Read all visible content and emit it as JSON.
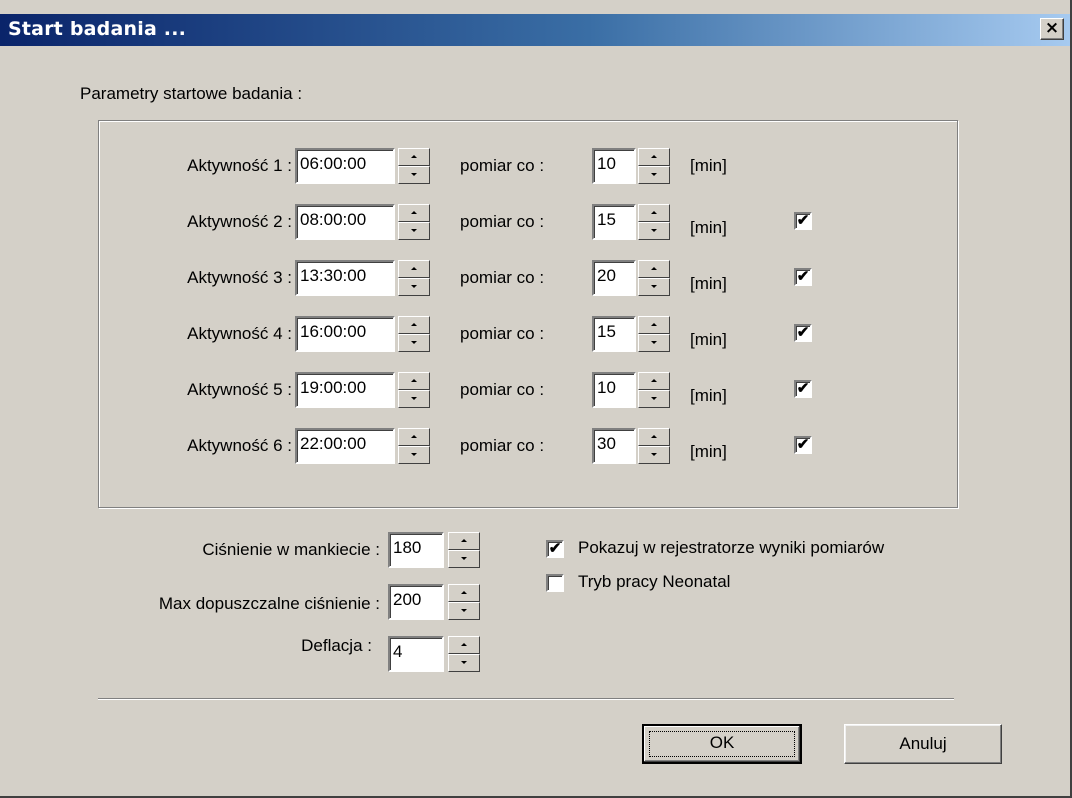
{
  "window": {
    "title": "Start badania ...",
    "close_label": "×"
  },
  "section_label": "Parametry startowe badania :",
  "activities": [
    {
      "label": "Aktywność 1 :",
      "time": "06:00:00",
      "interval_label": "pomiar co :",
      "interval": "10",
      "unit": "[min]",
      "enabled": null
    },
    {
      "label": "Aktywność 2 :",
      "time": "08:00:00",
      "interval_label": "pomiar co :",
      "interval": "15",
      "unit": "[min]",
      "enabled": "✔"
    },
    {
      "label": "Aktywność 3 :",
      "time": "13:30:00",
      "interval_label": "pomiar co :",
      "interval": "20",
      "unit": "[min]",
      "enabled": "✔"
    },
    {
      "label": "Aktywność 4 :",
      "time": "16:00:00",
      "interval_label": "pomiar co :",
      "interval": "15",
      "unit": "[min]",
      "enabled": "✔"
    },
    {
      "label": "Aktywność 5 :",
      "time": "19:00:00",
      "interval_label": "pomiar co :",
      "interval": "10",
      "unit": "[min]",
      "enabled": "✔"
    },
    {
      "label": "Aktywność 6 :",
      "time": "22:00:00",
      "interval_label": "pomiar co :",
      "interval": "30",
      "unit": "[min]",
      "enabled": "✔"
    }
  ],
  "pressure": {
    "cuff_label": "Ciśnienie w mankiecie :",
    "cuff_value": "180",
    "max_label": "Max dopuszczalne ciśnienie :",
    "max_value": "200",
    "deflation_label": "Deflacja :",
    "deflation_value": "4"
  },
  "options": {
    "show_results_label": "Pokazuj w rejestratorze wyniki pomiarów",
    "show_results_mark": "✔",
    "neonatal_label": "Tryb pracy Neonatal",
    "neonatal_mark": ""
  },
  "buttons": {
    "ok": "OK",
    "cancel": "Anuluj"
  }
}
